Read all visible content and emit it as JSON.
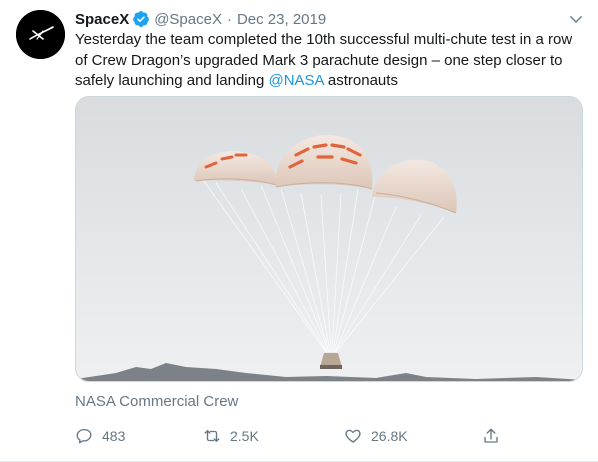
{
  "tweet": {
    "name": "SpaceX",
    "handle": "@SpaceX",
    "separator": "·",
    "date": "Dec 23, 2019",
    "text_line1": "Yesterday the team completed the 10th successful multi-chute test in a row",
    "text_line2": "of Crew Dragon’s upgraded Mark 3 parachute design – one step closer to",
    "text_line3_prefix": "safely launching and landing ",
    "mention": "@NASA",
    "text_line3_suffix": " astronauts",
    "media_credit": "NASA Commercial Crew",
    "reply_count": "483",
    "retweet_count": "2.5K",
    "like_count": "26.8K"
  },
  "icons": {
    "verified": "verified-badge-icon",
    "caret": "chevron-down-icon",
    "reply": "reply-icon",
    "retweet": "retweet-icon",
    "like": "heart-icon",
    "share": "share-icon"
  },
  "colors": {
    "link": "#1b95e0",
    "muted": "#657786",
    "verified": "#1da1f2"
  }
}
